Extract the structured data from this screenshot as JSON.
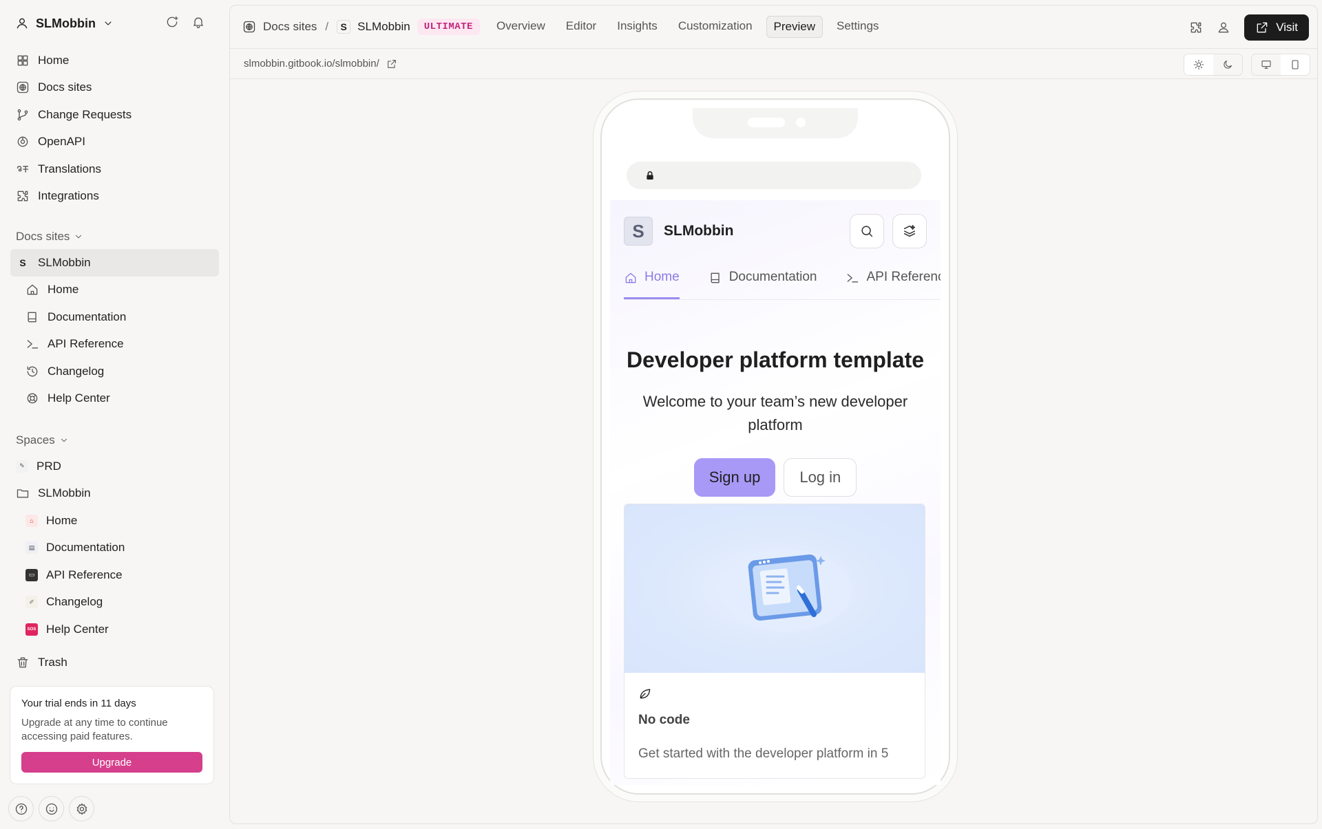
{
  "workspace": {
    "name": "SLMobbin"
  },
  "sidebar": {
    "main_items": [
      {
        "label": "Home"
      },
      {
        "label": "Docs sites"
      },
      {
        "label": "Change Requests"
      },
      {
        "label": "OpenAPI"
      },
      {
        "label": "Translations"
      },
      {
        "label": "Integrations"
      }
    ],
    "docs_sites_header": "Docs sites",
    "docs_site": {
      "initial": "S",
      "label": "SLMobbin"
    },
    "docs_site_pages": [
      {
        "label": "Home"
      },
      {
        "label": "Documentation"
      },
      {
        "label": "API Reference"
      },
      {
        "label": "Changelog"
      },
      {
        "label": "Help Center"
      }
    ],
    "spaces_header": "Spaces",
    "spaces": [
      {
        "label": "PRD"
      },
      {
        "label": "SLMobbin"
      }
    ],
    "space_pages": [
      {
        "label": "Home"
      },
      {
        "label": "Documentation"
      },
      {
        "label": "API Reference"
      },
      {
        "label": "Changelog"
      },
      {
        "label": "Help Center"
      }
    ],
    "trash": "Trash",
    "trial": {
      "title": "Your trial ends in 11 days",
      "text": "Upgrade at any time to continue accessing paid features.",
      "button": "Upgrade"
    }
  },
  "header": {
    "breadcrumb_root": "Docs sites",
    "separator": "/",
    "site_initial": "S",
    "site_name": "SLMobbin",
    "plan_badge": "ULTIMATE",
    "tabs": [
      {
        "label": "Overview"
      },
      {
        "label": "Editor"
      },
      {
        "label": "Insights"
      },
      {
        "label": "Customization"
      },
      {
        "label": "Preview"
      },
      {
        "label": "Settings"
      }
    ],
    "active_tab": "Preview",
    "visit_label": "Visit"
  },
  "url": {
    "text": "slmobbin.gitbook.io/slmobbin/"
  },
  "preview": {
    "site_initial": "S",
    "site_name": "SLMobbin",
    "tabs": [
      {
        "label": "Home"
      },
      {
        "label": "Documentation"
      },
      {
        "label": "API Reference"
      }
    ],
    "hero_title": "Developer platform template",
    "hero_subtitle": "Welcome to your team’s new developer platform",
    "signup": "Sign up",
    "login": "Log in",
    "card_title": "No code",
    "card_text": "Get started with the developer platform in 5"
  },
  "colors": {
    "accent_pink": "#d53f8c",
    "preview_accent": "#a899f6",
    "visit_bg": "#1c1c1c"
  }
}
